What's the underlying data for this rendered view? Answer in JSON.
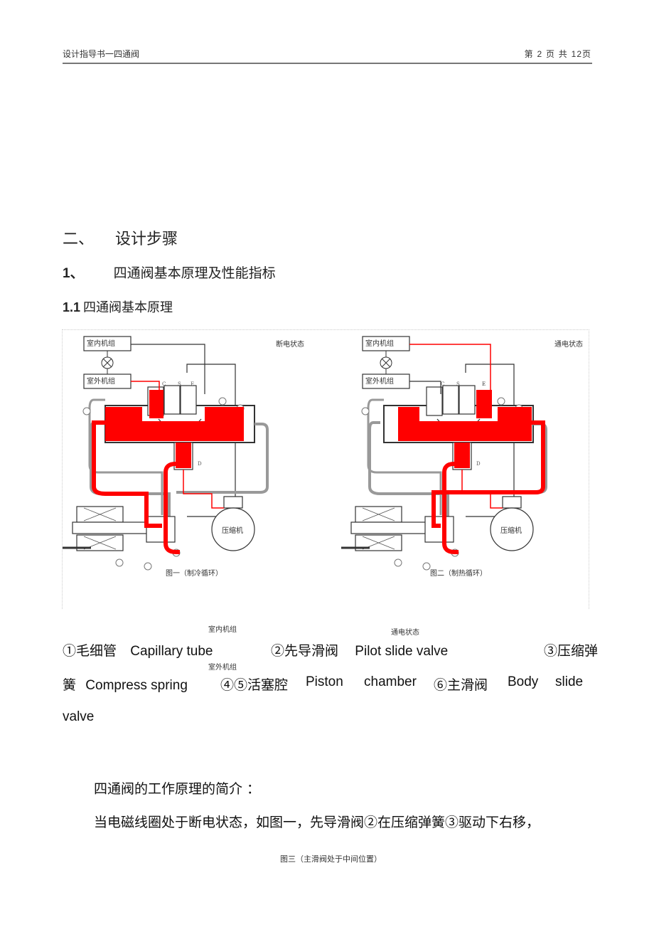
{
  "header": {
    "doc_title": "设计指导书一四通阀",
    "page_prefix": "第",
    "page_current": "2",
    "page_mid": "页  共",
    "page_total": "12页"
  },
  "sections": {
    "h1_num": "二、",
    "h1_text": "设计步骤",
    "h2_num": "1、",
    "h2_text": "四通阀基本原理及性能指标",
    "h3_num": "1.1",
    "h3_text": "四通阀基本原理"
  },
  "figure": {
    "left": {
      "state_label": "断电状态",
      "indoor_unit": "室内机组",
      "outdoor_unit": "室外机组",
      "compressor": "压缩机",
      "port_c": "C",
      "port_s": "S",
      "port_e": "E",
      "port_d": "D",
      "caption": "图一（制冷循环）",
      "markers": [
        "①",
        "②",
        "③",
        "④",
        "⑤",
        "⑥"
      ]
    },
    "right": {
      "state_label": "通电状态",
      "indoor_unit": "室内机组",
      "outdoor_unit": "室外机组",
      "compressor": "压缩机",
      "port_c": "C",
      "port_s": "S",
      "port_e": "E",
      "port_d": "D",
      "caption": "图二（制热循环）",
      "markers": [
        "①",
        "②",
        "③",
        "④",
        "⑤",
        "⑥"
      ]
    },
    "colors": {
      "flow_red": "#ff0000",
      "line": "#333333"
    }
  },
  "stray_labels": {
    "indoor": "室内机组",
    "powered": "通电状态",
    "outdoor": "室外机组",
    "fig3_caption": "图三（主滑阀处于中间位置）"
  },
  "legend": {
    "line1": {
      "item1_cn": "①毛细管",
      "item1_en": "Capillary tube",
      "item2_cn": "②先导滑阀",
      "item2_en": "Pilot slide valve",
      "item3_cn": "③压缩弹"
    },
    "line2": {
      "item3_cn_cont": "簧",
      "item3_en": "Compress  spring",
      "item4_cn": "④⑤活塞腔",
      "item4_en_a": "Piston",
      "item4_en_b": "chamber",
      "item6_cn": "⑥主滑阀",
      "item6_en_a": "Body",
      "item6_en_b": "slide"
    },
    "line3": "valve"
  },
  "body": {
    "intro": "四通阀的工作原理的简介  ：",
    "para1": "当电磁线圈处于断电状态，如图一，先导滑阀②在压缩弹簧③驱动下右移，"
  }
}
